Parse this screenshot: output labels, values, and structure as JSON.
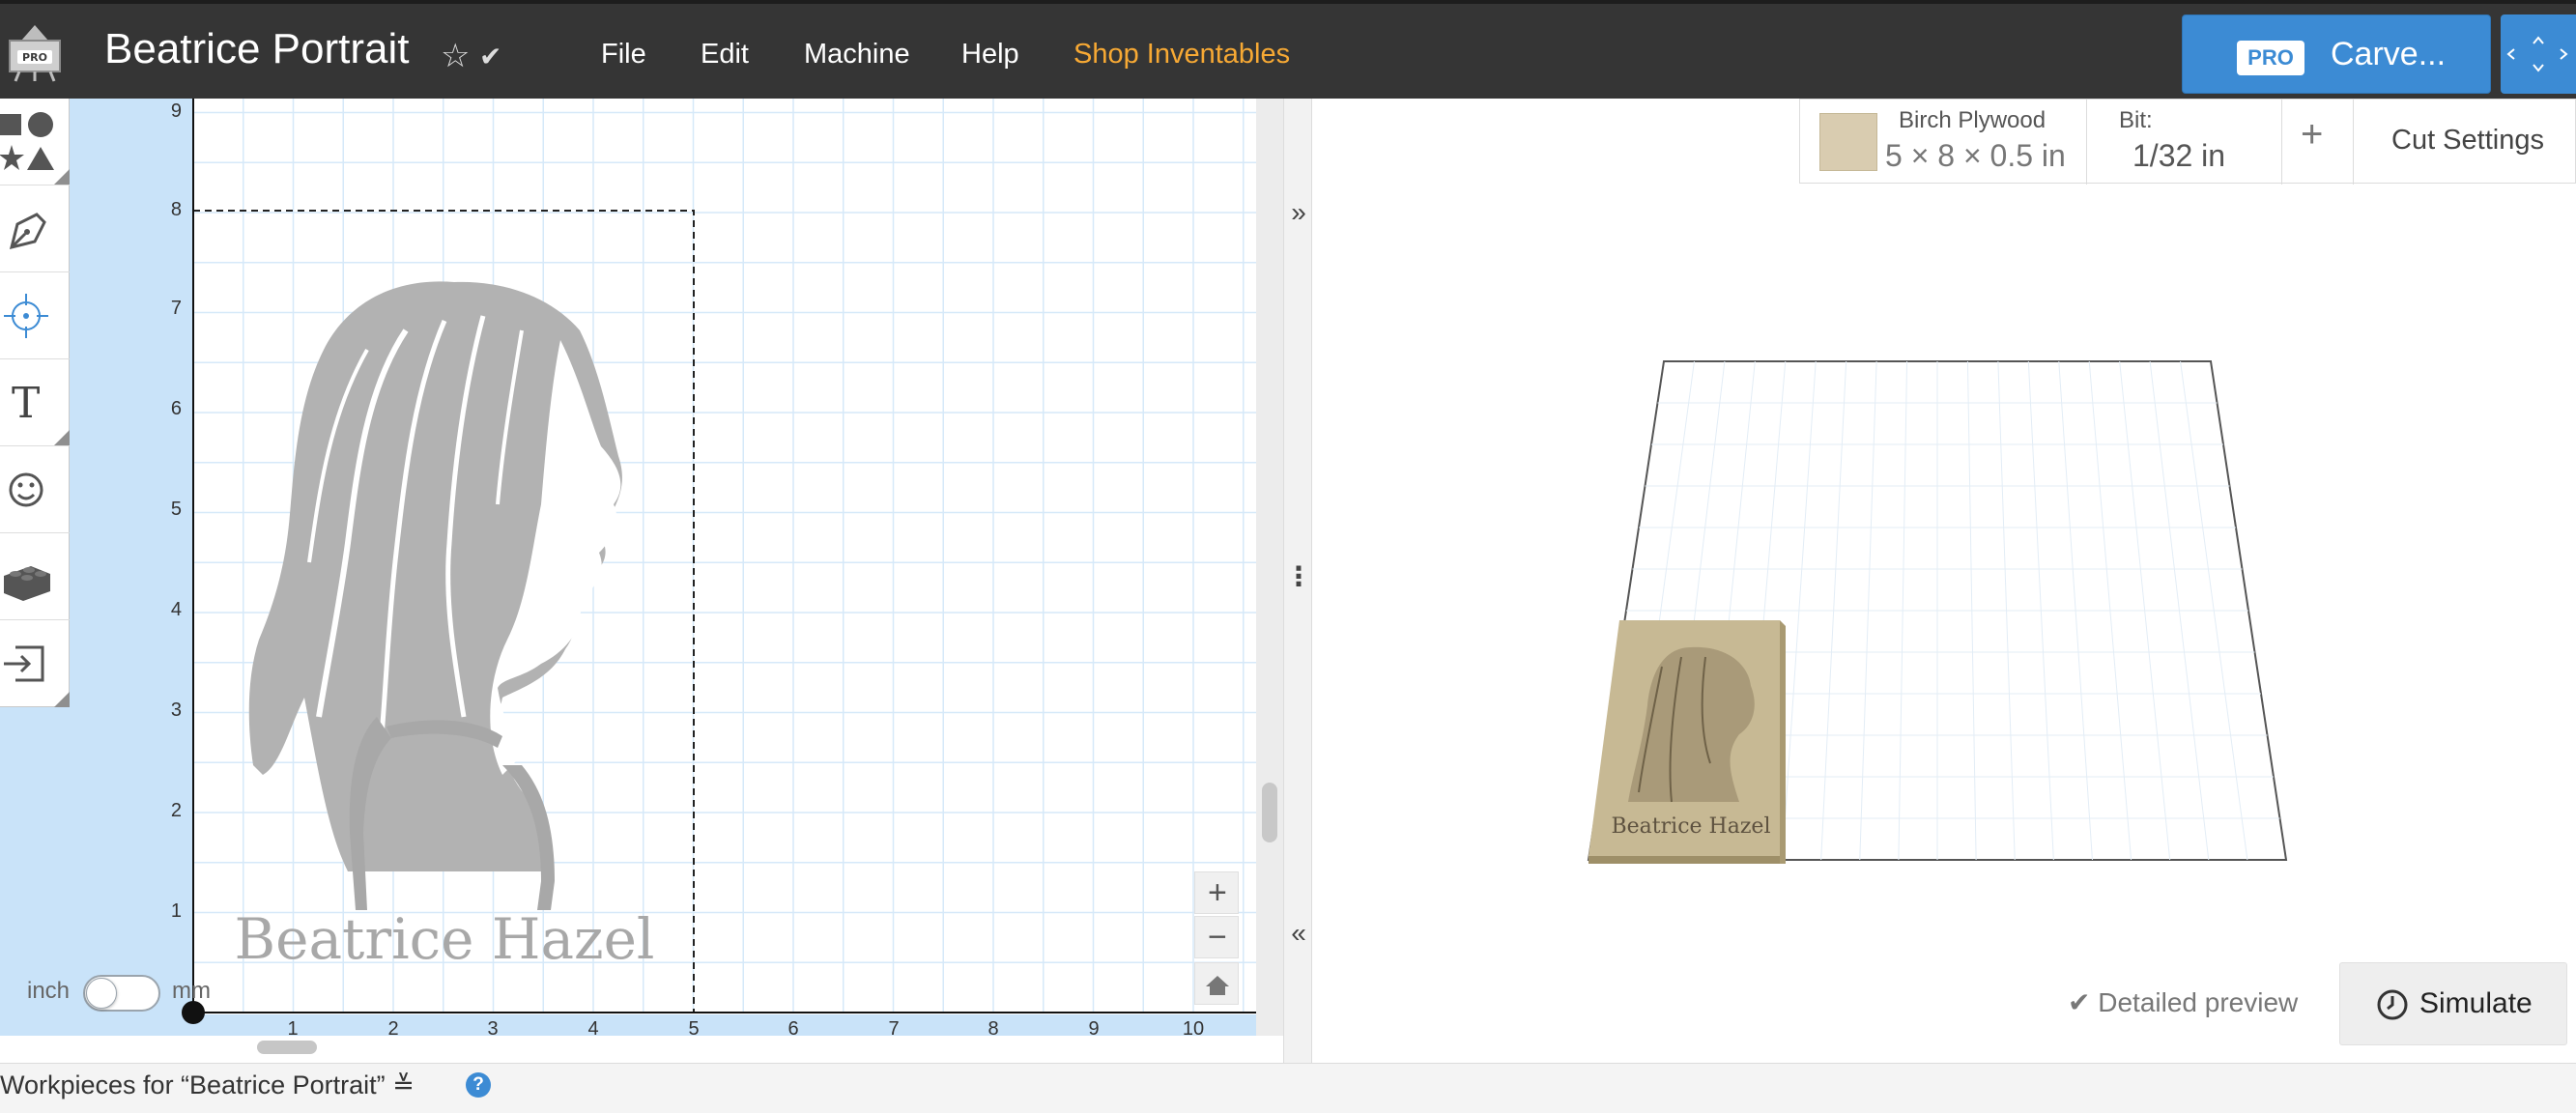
{
  "header": {
    "title": "Beatrice Portrait",
    "star_icon": "☆",
    "check_icon": "✔",
    "menu": [
      "File",
      "Edit",
      "Machine",
      "Help"
    ],
    "shop_label": "Shop Inventables",
    "carve": {
      "badge": "PRO",
      "label": "Carve..."
    },
    "app_logo_badge": "PRO"
  },
  "canvas": {
    "y_ticks": [
      "9",
      "8",
      "7",
      "6",
      "5",
      "4",
      "3",
      "2",
      "1"
    ],
    "x_ticks": [
      "1",
      "2",
      "3",
      "4",
      "5",
      "6",
      "7",
      "8",
      "9",
      "10"
    ],
    "workpiece_text": "Beatrice Hazel",
    "units": {
      "left": "inch",
      "right": "mm",
      "selected": "inch"
    },
    "zoom": {
      "in": "+",
      "out": "−",
      "home": "home-icon"
    }
  },
  "tools": [
    {
      "name": "shapes"
    },
    {
      "name": "pen"
    },
    {
      "name": "target"
    },
    {
      "name": "text",
      "glyph": "T"
    },
    {
      "name": "emoji"
    },
    {
      "name": "lego"
    },
    {
      "name": "import"
    }
  ],
  "splitter": {
    "collapse_right": "»",
    "handle": "⋮",
    "collapse_left": "«"
  },
  "material": {
    "name": "Birch Plywood",
    "dims": "5 × 8 × 0.5 in",
    "bit_label": "Bit:",
    "bit_value": "1/32 in",
    "plus": "+",
    "cut_settings": "Cut Settings"
  },
  "preview": {
    "material_text": "Beatrice Hazel",
    "detailed_preview": "Detailed preview",
    "simulate": "Simulate"
  },
  "footer": {
    "workpieces": "Workpieces for “Beatrice Portrait” ≚",
    "help": "?"
  },
  "colors": {
    "topbar": "#353535",
    "accent_blue": "#3c8bd4",
    "shop_orange": "#f7a934",
    "canvas_bg": "#c9e3f9",
    "grid_line": "#d6e9f9",
    "portrait_grey": "#a8a8a8",
    "wood": "#c7b994"
  }
}
